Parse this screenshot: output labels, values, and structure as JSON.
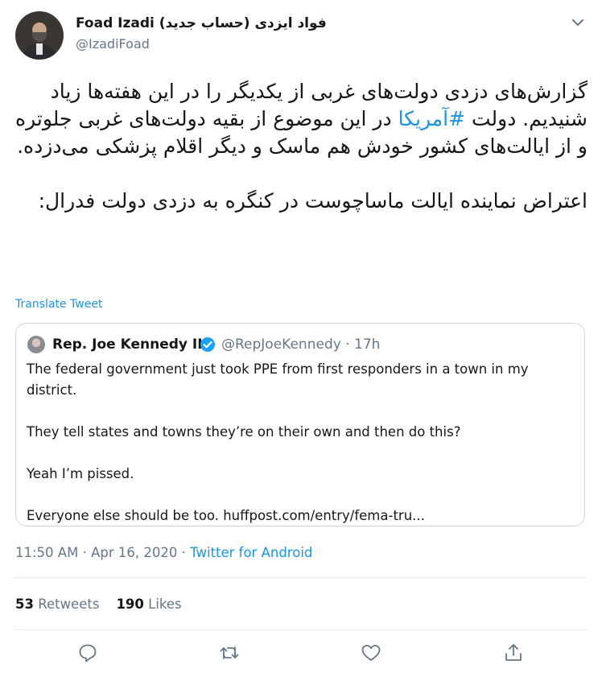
{
  "author": {
    "display_name": "Foad Izadi (فواد ایزدی (حساب جدید",
    "handle": "@IzadiFoad"
  },
  "tweet": {
    "paragraph1_before": "گزارش‌های دزدی دولت‌های غربی از یکدیگر را در این هفته‌ها زیاد شنیدیم. دولت ",
    "hashtag": "#آمریکا",
    "paragraph1_after": " در این موضوع از بقیه دولت‌های غربی جلوتره و از ایالت‌های کشور خودش هم ماسک و دیگر اقلام پزشکی می‌دزده.",
    "paragraph2": "اعتراض نماینده ایالت ماساچوست در کنگره به دزدی دولت فدرال:",
    "translate_label": "Translate Tweet"
  },
  "quoted_tweet": {
    "name": "Rep. Joe Kennedy III",
    "handle": "@RepJoeKennedy",
    "separator": "·",
    "time": "17h",
    "lines": [
      "The federal government just took PPE from first responders in a town in my district.",
      "They tell states and towns they’re on their own and then do this?",
      "Yeah I’m pissed.",
      "Everyone else should be too. huffpost.com/entry/fema-tru..."
    ]
  },
  "meta": {
    "time": "11:50 AM",
    "separator": "·",
    "date": "Apr 16, 2020",
    "source": "Twitter for Android"
  },
  "stats": {
    "retweets_count": "53",
    "retweets_label": "Retweets",
    "likes_count": "190",
    "likes_label": "Likes"
  },
  "icons": {
    "reply": "reply-icon",
    "retweet": "retweet-icon",
    "like": "like-icon",
    "share": "share-icon",
    "more": "chevron-down-icon",
    "verified": "verified-badge-icon"
  },
  "colors": {
    "link": "#1b95e0",
    "secondary_text": "#657786",
    "border": "#ccd6dd"
  }
}
